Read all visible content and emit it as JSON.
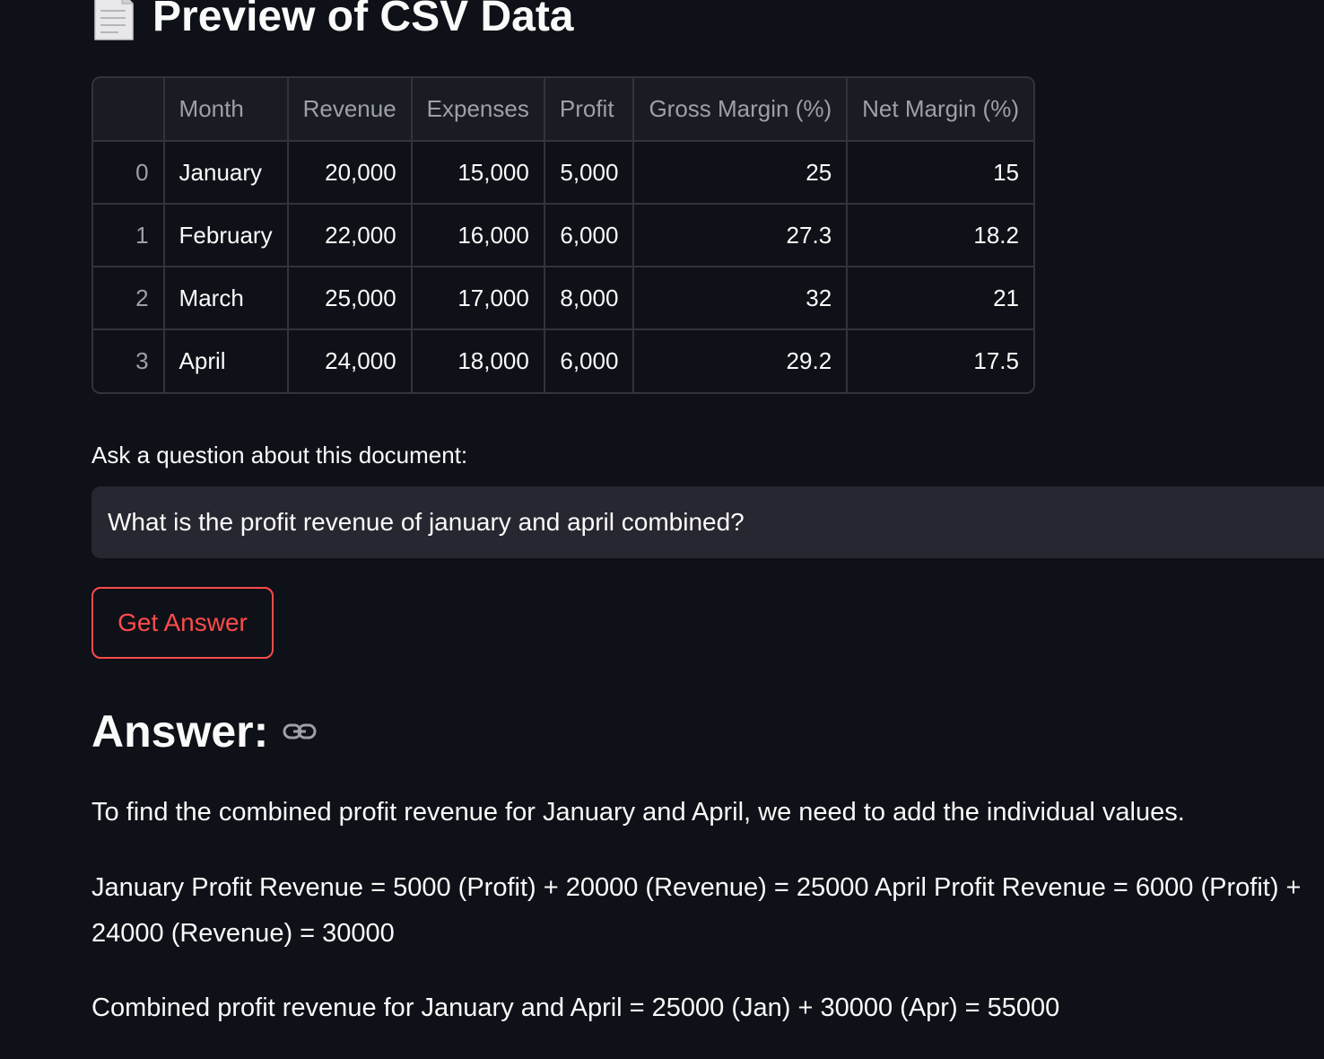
{
  "page": {
    "title": "Preview of CSV Data",
    "title_icon": "document-icon"
  },
  "table": {
    "columns": [
      "",
      "Month",
      "Revenue",
      "Expenses",
      "Profit",
      "Gross Margin (%)",
      "Net Margin (%)"
    ],
    "rows": [
      [
        "0",
        "January",
        "20,000",
        "15,000",
        "5,000",
        "25",
        "15"
      ],
      [
        "1",
        "February",
        "22,000",
        "16,000",
        "6,000",
        "27.3",
        "18.2"
      ],
      [
        "2",
        "March",
        "25,000",
        "17,000",
        "8,000",
        "32",
        "21"
      ],
      [
        "3",
        "April",
        "24,000",
        "18,000",
        "6,000",
        "29.2",
        "17.5"
      ]
    ]
  },
  "question": {
    "label": "Ask a question about this document:",
    "value": "What is the profit revenue of january and april combined?"
  },
  "button": {
    "label": "Get Answer"
  },
  "answer": {
    "heading": "Answer:",
    "anchor_icon": "link-icon",
    "paragraphs": [
      "To find the combined profit revenue for January and April, we need to add the individual values.",
      "January Profit Revenue = 5000 (Profit) + 20000 (Revenue) = 25000 April Profit Revenue = 6000 (Profit) + 24000 (Revenue) = 30000",
      "Combined profit revenue for January and April = 25000 (Jan) + 30000 (Apr) = 55000"
    ]
  },
  "colors": {
    "background": "#0e1117",
    "text": "#fafafa",
    "muted": "#9da0a8",
    "border": "#31333f",
    "input_bg": "#262730",
    "accent": "#ff4b4b"
  }
}
